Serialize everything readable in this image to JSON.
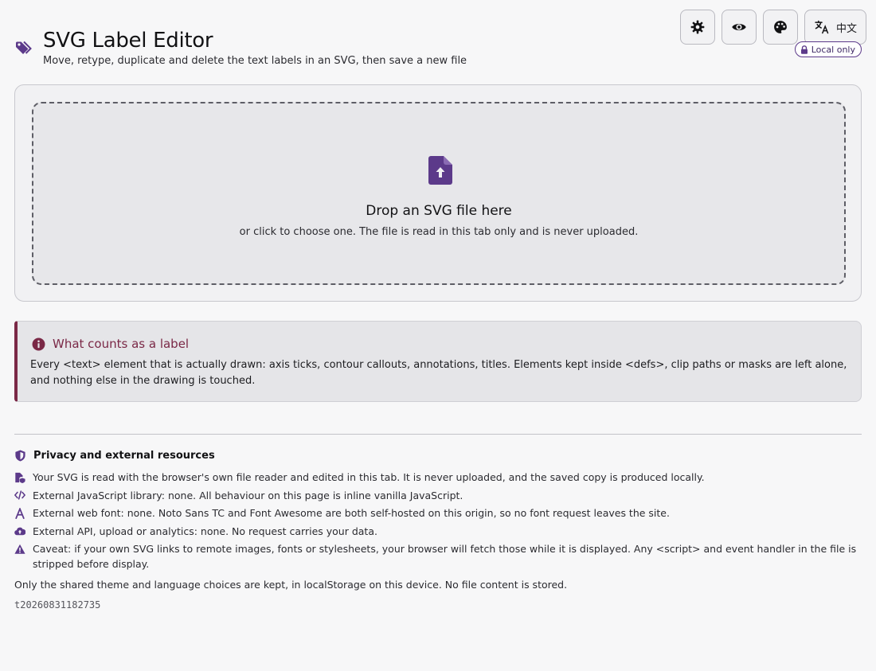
{
  "header": {
    "title": "SVG Label Editor",
    "subtitle": "Move, retype, duplicate and delete the text labels in an SVG, then save a new file",
    "title_icon": "tags-icon"
  },
  "toolbar": {
    "buttons": [
      {
        "icon": "gear-icon",
        "label": ""
      },
      {
        "icon": "eye-icon",
        "label": ""
      },
      {
        "icon": "palette-icon",
        "label": ""
      },
      {
        "icon": "language-icon",
        "label": "中文"
      }
    ]
  },
  "badge": {
    "label": "Local only",
    "icon": "lock-icon"
  },
  "dropzone": {
    "icon": "file-upload-icon",
    "title": "Drop an SVG file here",
    "subtitle": "or click to choose one. The file is read in this tab only and is never uploaded."
  },
  "callout": {
    "icon": "info-circle-icon",
    "title": "What counts as a label",
    "body": "Every <text> element that is actually drawn: axis ticks, contour callouts, annotations, titles. Elements kept inside <defs>, clip paths or masks are left alone, and nothing else in the drawing is touched."
  },
  "privacy": {
    "title": "Privacy and external resources",
    "icon": "shield-icon",
    "items": [
      {
        "icon": "file-shield-icon",
        "text": "Your SVG is read with the browser's own file reader and edited in this tab. It is never uploaded, and the saved copy is produced locally."
      },
      {
        "icon": "code-icon",
        "text": "External JavaScript library: none. All behaviour on this page is inline vanilla JavaScript."
      },
      {
        "icon": "font-icon",
        "text": "External web font: none. Noto Sans TC and Font Awesome are both self-hosted on this origin, so no font request leaves the site."
      },
      {
        "icon": "cloud-upload-icon",
        "text": "External API, upload or analytics: none. No request carries your data."
      },
      {
        "icon": "warning-triangle-icon",
        "text": "Caveat: if your own SVG links to remote images, fonts or stylesheets, your browser will fetch those while it is displayed. Any <script> and event handler in the file is stripped before display."
      }
    ],
    "storage_note": "Only the shared theme and language choices are kept, in localStorage on this device. No file content is stored.",
    "build_id": "t20260831182735"
  },
  "colors": {
    "accent": "#5c3a8a",
    "callout_accent": "#7a2846",
    "background": "#f7f7f8"
  }
}
